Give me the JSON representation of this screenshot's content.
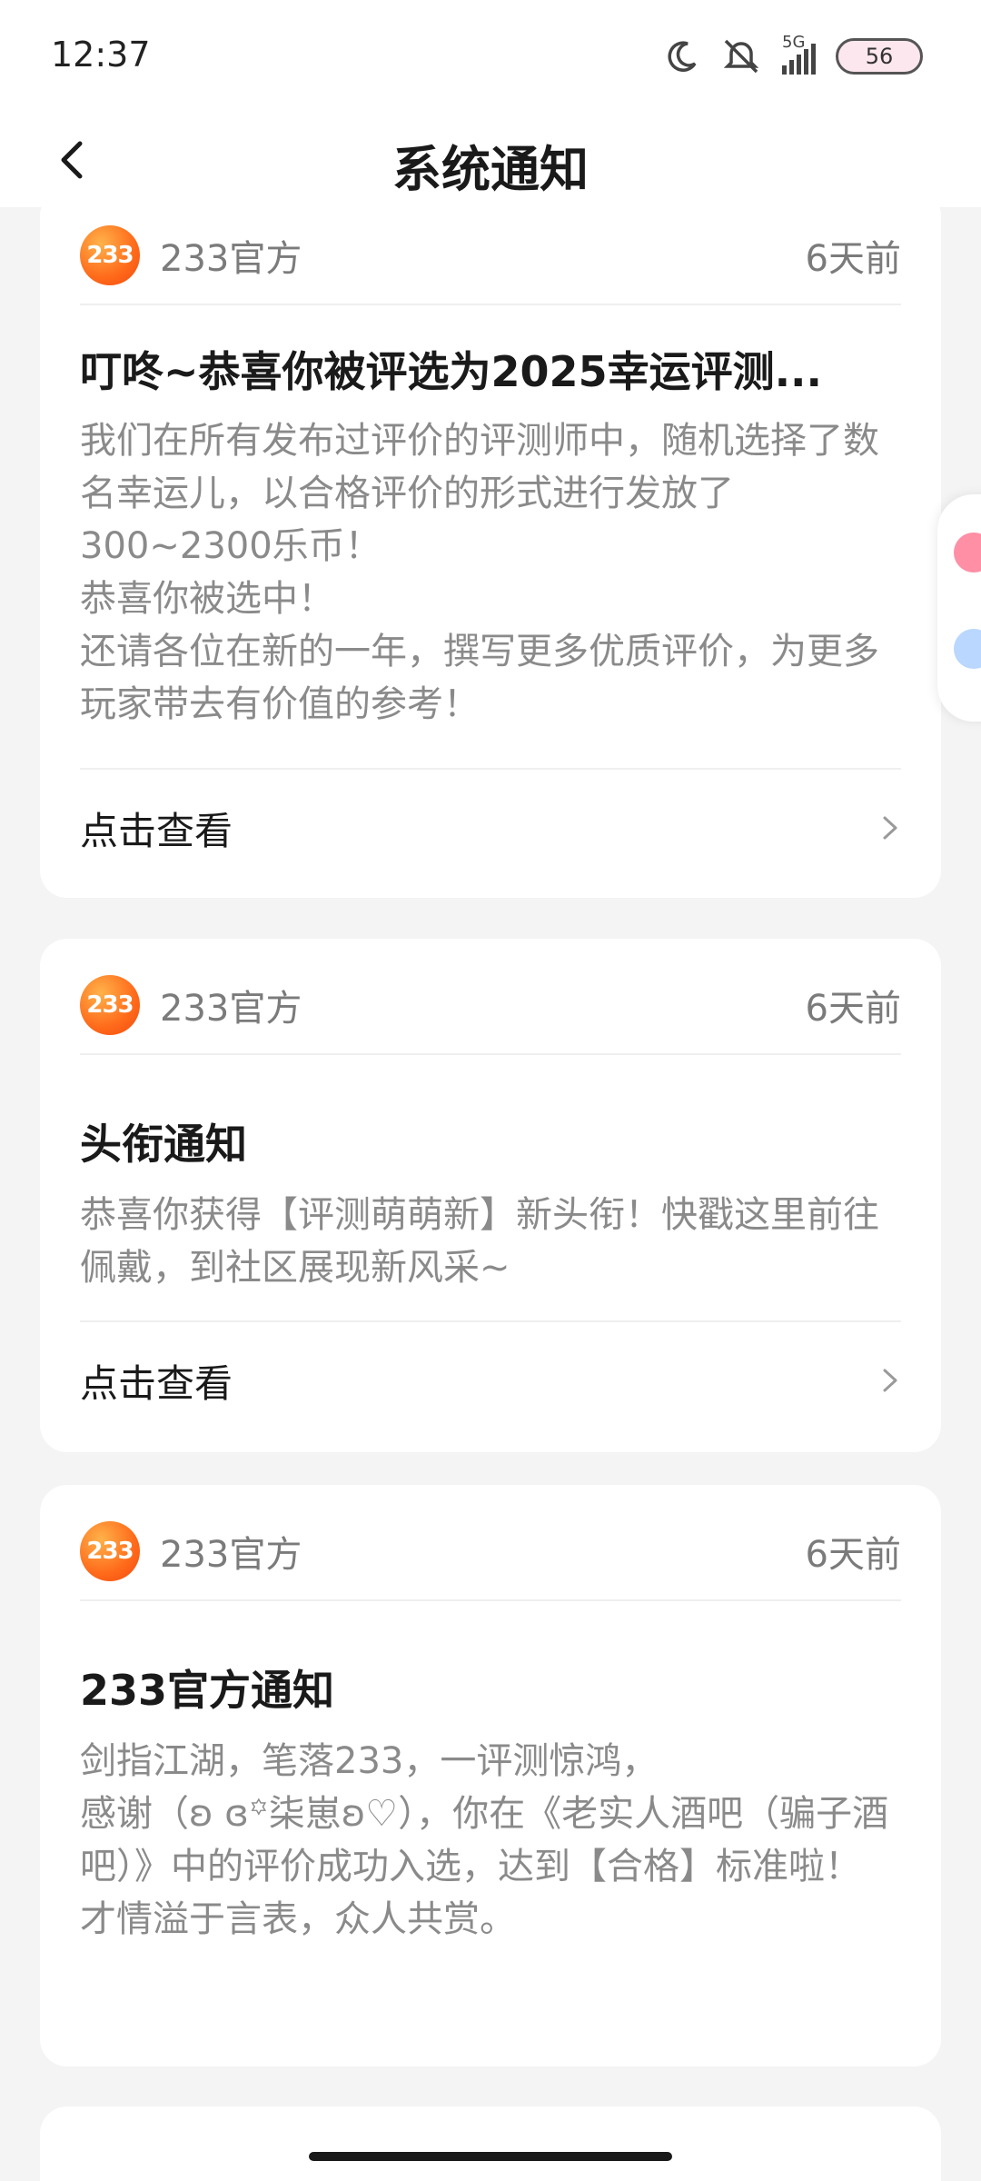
{
  "status_bar": {
    "time": "12:37",
    "network": "5G",
    "battery": "56",
    "icons": [
      "moon-icon",
      "bell-muted-icon",
      "signal-icon",
      "battery-icon"
    ]
  },
  "header": {
    "title": "系统通知",
    "back_icon": "chevron-left-icon"
  },
  "notifications": [
    {
      "sender": "233官方",
      "logo_text": "233",
      "time": "6天前",
      "title": "叮咚~恭喜你被评选为2025幸运评测...",
      "body_lines": [
        "我们在所有发布过评价的评测师中，随机选择了数名幸运儿，以合格评价的形式进行发放了300~2300乐币！",
        "恭喜你被选中！",
        "还请各位在新的一年，撰写更多优质评价，为更多玩家带去有价值的参考！"
      ],
      "action_label": "点击查看"
    },
    {
      "sender": "233官方",
      "logo_text": "233",
      "time": "6天前",
      "title": "头衔通知",
      "body_lines": [
        "恭喜你获得【评测萌萌新】新头衔！快戳这里前往佩戴，到社区展现新风采~"
      ],
      "action_label": "点击查看"
    },
    {
      "sender": "233官方",
      "logo_text": "233",
      "time": "6天前",
      "title": "233官方通知",
      "body_lines": [
        "剑指江湖，笔落233，一评测惊鸿，",
        "感谢（ʚ ɞ꙳柒崽ʚ♡），你在《老实人酒吧（骗子酒吧）》中的评价成功入选，达到【合格】标准啦！",
        "才情溢于言表，众人共赏。"
      ]
    }
  ],
  "colors": {
    "logo_orange": "#ff6a1a",
    "text_gray": "#8a8a8a",
    "background": "#f4f4f4"
  }
}
